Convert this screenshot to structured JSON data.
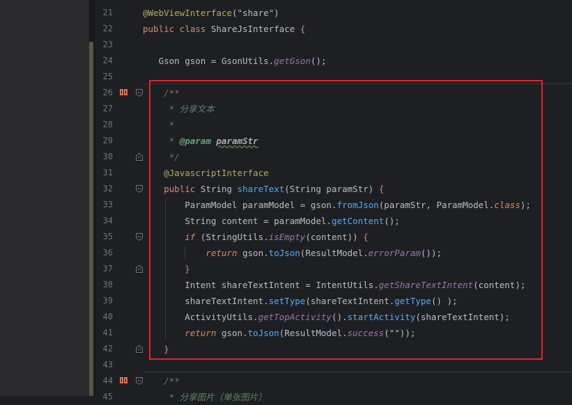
{
  "editor": {
    "lines": [
      {
        "num": "21",
        "tokens": [
          {
            "t": "@WebViewInterface",
            "c": "ann"
          },
          {
            "t": "(",
            "c": "pm"
          },
          {
            "t": "\"share\"",
            "c": "pm"
          },
          {
            "t": ")",
            "c": "pm"
          }
        ]
      },
      {
        "num": "22",
        "tokens": [
          {
            "t": "public class ",
            "c": "kw"
          },
          {
            "t": "ShareJsInterface ",
            "c": "cls"
          },
          {
            "t": "{",
            "c": "kw"
          }
        ]
      },
      {
        "num": "23",
        "tokens": []
      },
      {
        "num": "24",
        "tokens": [
          {
            "t": "   Gson gson ",
            "c": "pm"
          },
          {
            "t": "= ",
            "c": "pm"
          },
          {
            "t": "GsonUtils",
            "c": "pm"
          },
          {
            "t": ".",
            "c": "pm"
          },
          {
            "t": "getGson",
            "c": "sm"
          },
          {
            "t": "();",
            "c": "pm"
          }
        ]
      },
      {
        "num": "25",
        "tokens": []
      },
      {
        "num": "26",
        "tokens": [
          {
            "t": "    /**",
            "c": "doc"
          }
        ]
      },
      {
        "num": "27",
        "tokens": [
          {
            "t": "     * 分享文本",
            "c": "doc"
          }
        ]
      },
      {
        "num": "28",
        "tokens": [
          {
            "t": "     *",
            "c": "doc"
          }
        ]
      },
      {
        "num": "29",
        "tokens": [
          {
            "t": "     * ",
            "c": "doc"
          },
          {
            "t": "@param ",
            "c": "doctag"
          },
          {
            "t": "paramStr",
            "c": "docpm"
          }
        ]
      },
      {
        "num": "30",
        "tokens": [
          {
            "t": "     */",
            "c": "doc"
          }
        ]
      },
      {
        "num": "31",
        "tokens": [
          {
            "t": "    @JavascriptInterface",
            "c": "ann"
          }
        ]
      },
      {
        "num": "32",
        "tokens": [
          {
            "t": "    public ",
            "c": "kw"
          },
          {
            "t": "String ",
            "c": "pm"
          },
          {
            "t": "shareText",
            "c": "fn"
          },
          {
            "t": "(",
            "c": "pm"
          },
          {
            "t": "String paramStr",
            "c": "pm"
          },
          {
            "t": ") ",
            "c": "pm"
          },
          {
            "t": "{",
            "c": "kw"
          }
        ]
      },
      {
        "num": "33",
        "tokens": [
          {
            "t": "        ParamModel paramModel ",
            "c": "pm"
          },
          {
            "t": "= gson.",
            "c": "pm"
          },
          {
            "t": "fromJson",
            "c": "mt"
          },
          {
            "t": "(paramStr, ParamModel.",
            "c": "pm"
          },
          {
            "t": "class",
            "c": "lit"
          },
          {
            "t": ");",
            "c": "pm"
          }
        ]
      },
      {
        "num": "34",
        "tokens": [
          {
            "t": "        String content ",
            "c": "pm"
          },
          {
            "t": "= paramModel.",
            "c": "pm"
          },
          {
            "t": "getContent",
            "c": "mt"
          },
          {
            "t": "();",
            "c": "pm"
          }
        ]
      },
      {
        "num": "35",
        "tokens": [
          {
            "t": "        if ",
            "c": "lit"
          },
          {
            "t": "(StringUtils.",
            "c": "pm"
          },
          {
            "t": "isEmpty",
            "c": "sm"
          },
          {
            "t": "(content)) ",
            "c": "pm"
          },
          {
            "t": "{",
            "c": "kw"
          }
        ]
      },
      {
        "num": "36",
        "tokens": [
          {
            "t": "            return ",
            "c": "lit"
          },
          {
            "t": "gson.",
            "c": "pm"
          },
          {
            "t": "toJson",
            "c": "mt"
          },
          {
            "t": "(ResultModel.",
            "c": "pm"
          },
          {
            "t": "errorParam",
            "c": "sm"
          },
          {
            "t": "());",
            "c": "pm"
          }
        ]
      },
      {
        "num": "37",
        "tokens": [
          {
            "t": "        }",
            "c": "kw"
          }
        ]
      },
      {
        "num": "38",
        "tokens": [
          {
            "t": "        Intent shareTextIntent ",
            "c": "pm"
          },
          {
            "t": "= IntentUtils.",
            "c": "pm"
          },
          {
            "t": "getShareTextIntent",
            "c": "sm"
          },
          {
            "t": "(content);",
            "c": "pm"
          }
        ]
      },
      {
        "num": "39",
        "tokens": [
          {
            "t": "        shareTextIntent.",
            "c": "pm"
          },
          {
            "t": "setType",
            "c": "mt"
          },
          {
            "t": "(shareTextIntent.",
            "c": "pm"
          },
          {
            "t": "getType",
            "c": "mt"
          },
          {
            "t": "() );",
            "c": "pm"
          }
        ]
      },
      {
        "num": "40",
        "tokens": [
          {
            "t": "        ActivityUtils.",
            "c": "pm"
          },
          {
            "t": "getTopActivity",
            "c": "sm"
          },
          {
            "t": "().",
            "c": "pm"
          },
          {
            "t": "startActivity",
            "c": "mt"
          },
          {
            "t": "(shareTextIntent);",
            "c": "pm"
          }
        ]
      },
      {
        "num": "41",
        "tokens": [
          {
            "t": "        return ",
            "c": "lit"
          },
          {
            "t": "gson.",
            "c": "pm"
          },
          {
            "t": "toJson",
            "c": "mt"
          },
          {
            "t": "(ResultModel.",
            "c": "pm"
          },
          {
            "t": "success",
            "c": "sm"
          },
          {
            "t": "(\"\"));",
            "c": "pm"
          }
        ]
      },
      {
        "num": "42",
        "tokens": [
          {
            "t": "    }",
            "c": "kw"
          }
        ]
      },
      {
        "num": "43",
        "tokens": []
      },
      {
        "num": "44",
        "tokens": [
          {
            "t": "    /**",
            "c": "doc"
          }
        ]
      },
      {
        "num": "45",
        "tokens": [
          {
            "t": "     * 分享图片（单张图片）",
            "c": "doc"
          }
        ]
      }
    ]
  },
  "gutter_markers": [
    {
      "line": "26",
      "icons": [
        "bookmark-icon",
        "fold-icon"
      ]
    },
    {
      "line": "30",
      "icons": [
        "fold-end-icon"
      ]
    },
    {
      "line": "32",
      "icons": [
        "fold-icon"
      ]
    },
    {
      "line": "35",
      "icons": [
        "fold-icon"
      ]
    },
    {
      "line": "37",
      "icons": [
        "fold-end-icon"
      ]
    },
    {
      "line": "42",
      "icons": [
        "fold-end-icon"
      ]
    },
    {
      "line": "44",
      "icons": [
        "bookmark-icon",
        "fold-icon"
      ]
    }
  ],
  "colors": {
    "background": "#1e1f22",
    "keyword": "#cf8e6d",
    "annotation": "#b3ae60",
    "method": "#56a8f5",
    "string": "#6aab73",
    "comment": "#5f826b",
    "highlight_border": "#e0262c"
  }
}
